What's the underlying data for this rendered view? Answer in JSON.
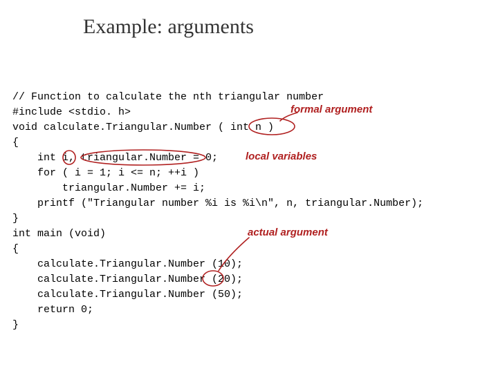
{
  "title": "Example: arguments",
  "code": "// Function to calculate the nth triangular number\n#include <stdio. h>\nvoid calculate.Triangular.Number ( int n )\n{\n    int i, triangular.Number = 0;\n    for ( i = 1; i <= n; ++i )\n        triangular.Number += i;\n    printf (\"Triangular number %i is %i\\n\", n, triangular.Number);\n}\nint main (void)\n{\n    calculate.Triangular.Number (10);\n    calculate.Triangular.Number (20);\n    calculate.Triangular.Number (50);\n    return 0;\n}",
  "annotations": {
    "formal_argument": "formal argument",
    "local_variables": "local variables",
    "actual_argument": "actual argument"
  }
}
